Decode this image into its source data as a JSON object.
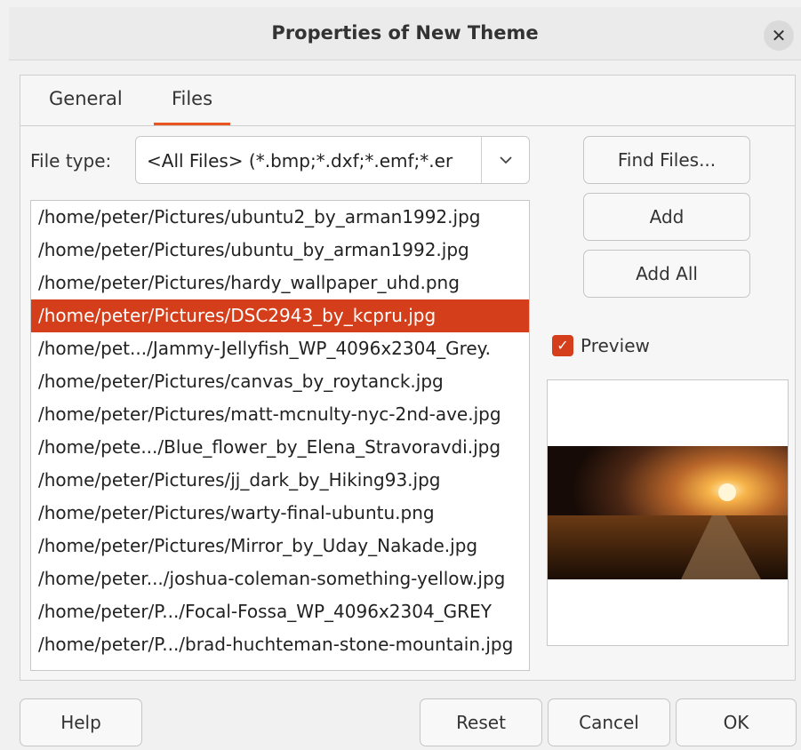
{
  "dialog": {
    "title": "Properties of New Theme",
    "close_icon": "close-icon"
  },
  "tabs": [
    {
      "label": "General",
      "active": false
    },
    {
      "label": "Files",
      "active": true
    }
  ],
  "files_tab": {
    "file_type_label": "File type:",
    "file_type_value": "<All Files> (*.bmp;*.dxf;*.emf;*.er",
    "dropdown_icon": "chevron-down-icon",
    "files": [
      "/home/peter/Pictures/ubuntu2_by_arman1992.jpg",
      "/home/peter/Pictures/ubuntu_by_arman1992.jpg",
      "/home/peter/Pictures/hardy_wallpaper_uhd.png",
      "/home/peter/Pictures/DSC2943_by_kcpru.jpg",
      "/home/pet.../Jammy-Jellyfish_WP_4096x2304_Grey.",
      "/home/peter/Pictures/canvas_by_roytanck.jpg",
      "/home/peter/Pictures/matt-mcnulty-nyc-2nd-ave.jpg",
      "/home/pete.../Blue_flower_by_Elena_Stravoravdi.jpg",
      "/home/peter/Pictures/jj_dark_by_Hiking93.jpg",
      "/home/peter/Pictures/warty-final-ubuntu.png",
      "/home/peter/Pictures/Mirror_by_Uday_Nakade.jpg",
      "/home/peter.../joshua-coleman-something-yellow.jpg",
      "/home/peter/P.../Focal-Fossa_WP_4096x2304_GREY",
      "/home/peter/P.../brad-huchteman-stone-mountain.jpg"
    ],
    "selected_index": 3,
    "find_files_label": "Find Files...",
    "add_label": "Add",
    "add_all_label": "Add All",
    "preview_label": "Preview",
    "preview_checked": true
  },
  "footer": {
    "help_label": "Help",
    "reset_label": "Reset",
    "cancel_label": "Cancel",
    "ok_label": "OK"
  },
  "colors": {
    "accent": "#e95420",
    "selection": "#d43e1a"
  }
}
